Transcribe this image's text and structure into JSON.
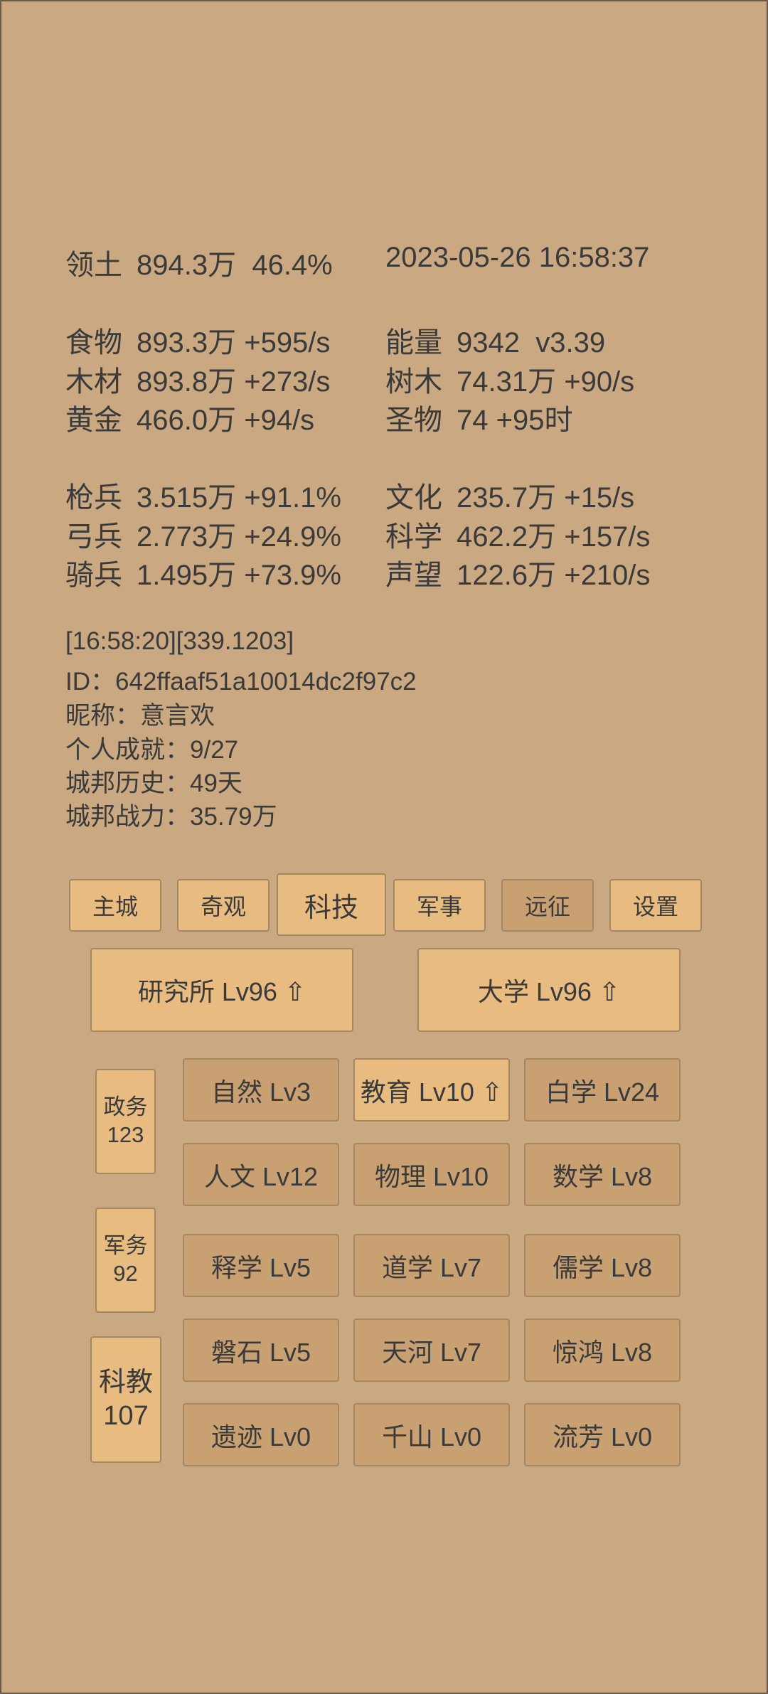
{
  "header": {
    "territory_label": "领土",
    "territory_value": "894.3万  46.4%",
    "datetime": "2023-05-26 16:58:37"
  },
  "resources": {
    "food_label": "食物",
    "food_value": "893.3万 +595/s",
    "energy_label": "能量",
    "energy_value": "9342  v3.39",
    "timber_label": "木材",
    "timber_value": "893.8万 +273/s",
    "trees_label": "树木",
    "trees_value": "74.31万 +90/s",
    "gold_label": "黄金",
    "gold_value": "466.0万 +94/s",
    "relic_label": "圣物",
    "relic_value": "74 +95时"
  },
  "military": {
    "spear_label": "枪兵",
    "spear_value": "3.515万 +91.1%",
    "culture_label": "文化",
    "culture_value": "235.7万 +15/s",
    "archer_label": "弓兵",
    "archer_value": "2.773万 +24.9%",
    "science_label": "科学",
    "science_value": "462.2万 +157/s",
    "cavalry_label": "骑兵",
    "cavalry_value": "1.495万 +73.9%",
    "prestige_label": "声望",
    "prestige_value": "122.6万 +210/s"
  },
  "info": {
    "timestamp": "[16:58:20][339.1203]",
    "id": "ID：642ffaaf51a10014dc2f97c2",
    "nickname": "昵称：意言欢",
    "achievements": "个人成就：9/27",
    "history": "城邦历史：49天",
    "power": "城邦战力：35.79万"
  },
  "tabs": [
    "主城",
    "奇观",
    "科技",
    "军事",
    "远征",
    "设置"
  ],
  "buildings": {
    "institute": "研究所 Lv96 ⇧",
    "university": "大学 Lv96 ⇧"
  },
  "side": {
    "politics_label": "政务",
    "politics_value": "123",
    "military_label": "军务",
    "military_value": "92",
    "scitech_label": "科教",
    "scitech_value": "107"
  },
  "techs": [
    "自然 Lv3",
    "教育 Lv10 ⇧",
    "白学 Lv24",
    "人文 Lv12",
    "物理 Lv10",
    "数学 Lv8",
    "释学 Lv5",
    "道学 Lv7",
    "儒学 Lv8",
    "磐石 Lv5",
    "天河 Lv7",
    "惊鸿 Lv8",
    "遗迹 Lv0",
    "千山 Lv0",
    "流芳 Lv0"
  ]
}
